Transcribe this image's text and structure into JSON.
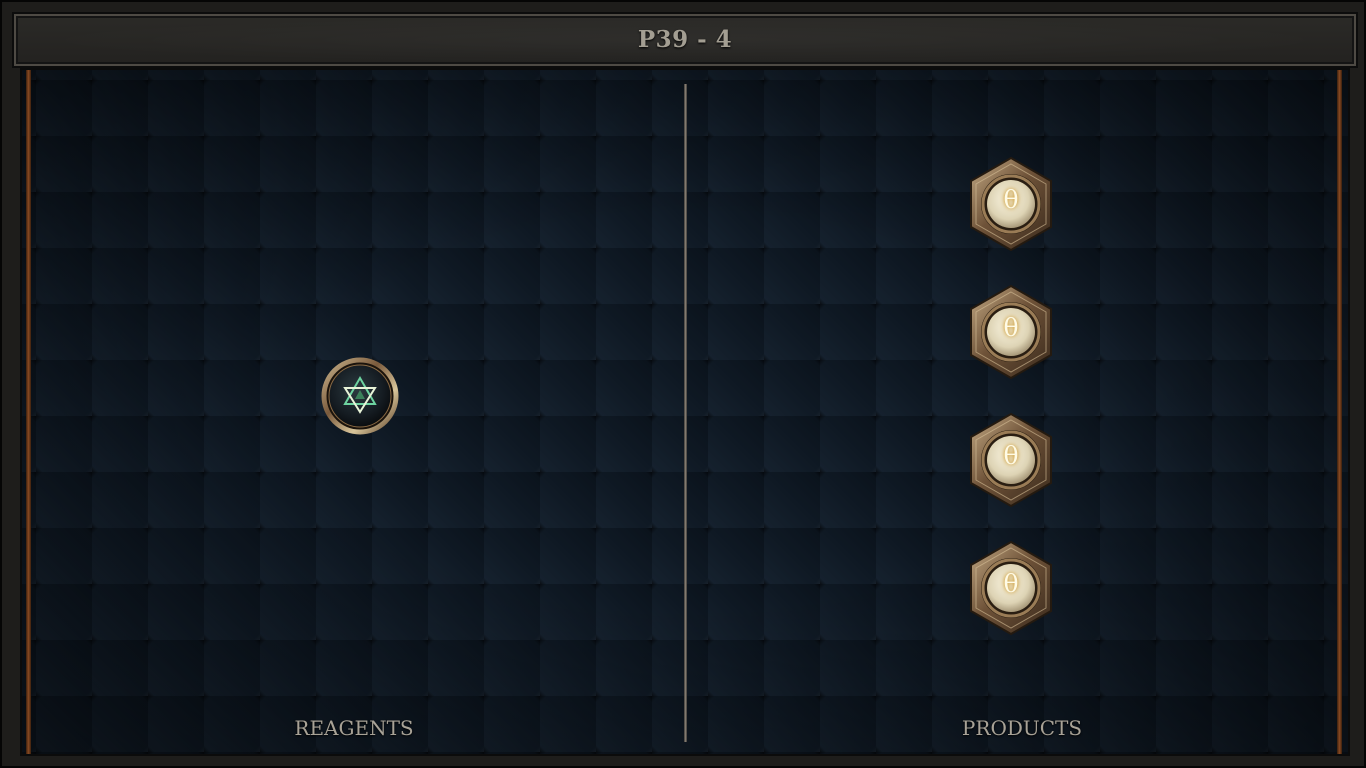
{
  "title": "P39 - 4",
  "panels": {
    "reagents_label": "REAGENTS",
    "products_label": "PRODUCTS"
  },
  "reagents": [
    {
      "icon": "hexagram-orb-icon",
      "glyph": "✡",
      "glyph_color": "#e8f4d8",
      "accent": "#3e8a5e"
    }
  ],
  "products": [
    {
      "icon": "theta-slot-icon",
      "glyph": "θ"
    },
    {
      "icon": "theta-slot-icon",
      "glyph": "θ"
    },
    {
      "icon": "theta-slot-icon",
      "glyph": "θ"
    },
    {
      "icon": "theta-slot-icon",
      "glyph": "θ"
    }
  ],
  "colors": {
    "frame_bronze": "#7a5a3c",
    "orb_cream": "#e8e0c4",
    "rail_copper": "#8a4a22",
    "label_text": "#a8a296"
  }
}
